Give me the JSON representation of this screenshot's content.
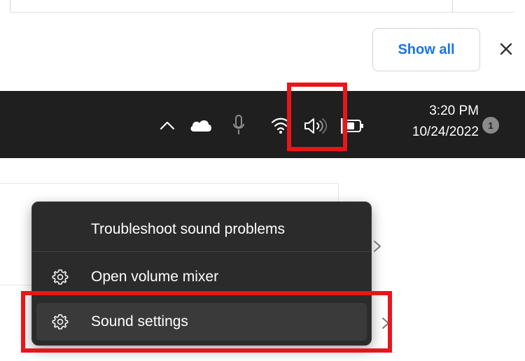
{
  "download_bar": {
    "show_all_label": "Show all",
    "close_icon": "close-icon"
  },
  "taskbar": {
    "tray_icons": [
      "chevron-up-icon",
      "onedrive-cloud-icon",
      "microphone-icon",
      "wifi-icon",
      "speaker-volume-icon",
      "battery-icon"
    ],
    "time": "3:20 PM",
    "date": "10/24/2022",
    "notification_count": "1"
  },
  "context_menu": {
    "items": [
      {
        "label": "Troubleshoot sound problems"
      },
      {
        "label": "Open volume mixer",
        "icon": "gear-icon"
      },
      {
        "label": "Sound settings",
        "icon": "gear-icon"
      }
    ]
  },
  "colors": {
    "taskbar_bg": "#1f1f1f",
    "menu_bg": "#2b2b2b",
    "accent_link": "#1a73e8",
    "highlight_box": "#e8161b"
  }
}
